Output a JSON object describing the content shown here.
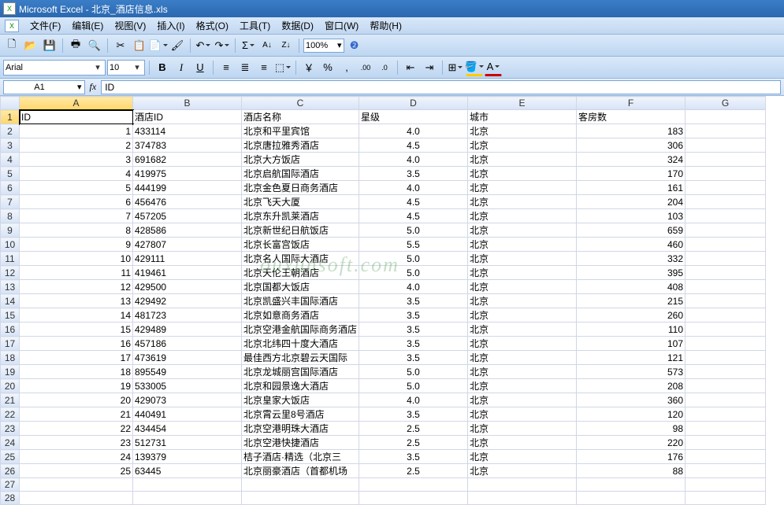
{
  "title": "Microsoft Excel - 北京_酒店信息.xls",
  "menus": [
    "文件(F)",
    "编辑(E)",
    "视图(V)",
    "插入(I)",
    "格式(O)",
    "工具(T)",
    "数据(D)",
    "窗口(W)",
    "帮助(H)"
  ],
  "font": {
    "name": "Arial",
    "size": "10"
  },
  "zoom": "100%",
  "namebox": "A1",
  "formula": "ID",
  "watermark": "ouxunsoft.com",
  "cols": [
    "A",
    "B",
    "C",
    "D",
    "E",
    "F",
    "G"
  ],
  "headers": [
    "ID",
    "酒店ID",
    "酒店名称",
    "星级",
    "城市",
    "客房数"
  ],
  "rows": [
    {
      "id": 1,
      "hid": "433114",
      "name": "北京和平里宾馆",
      "star": "4.0",
      "city": "北京",
      "rooms": "183"
    },
    {
      "id": 2,
      "hid": "374783",
      "name": "北京唐拉雅秀酒店",
      "star": "4.5",
      "city": "北京",
      "rooms": "306"
    },
    {
      "id": 3,
      "hid": "691682",
      "name": "北京大方饭店",
      "star": "4.0",
      "city": "北京",
      "rooms": "324"
    },
    {
      "id": 4,
      "hid": "419975",
      "name": "北京启航国际酒店",
      "star": "3.5",
      "city": "北京",
      "rooms": "170"
    },
    {
      "id": 5,
      "hid": "444199",
      "name": "北京金色夏日商务酒店",
      "star": "4.0",
      "city": "北京",
      "rooms": "161"
    },
    {
      "id": 6,
      "hid": "456476",
      "name": "北京飞天大厦",
      "star": "4.5",
      "city": "北京",
      "rooms": "204"
    },
    {
      "id": 7,
      "hid": "457205",
      "name": "北京东升凯莱酒店",
      "star": "4.5",
      "city": "北京",
      "rooms": "103"
    },
    {
      "id": 8,
      "hid": "428586",
      "name": "北京新世纪日航饭店",
      "star": "5.0",
      "city": "北京",
      "rooms": "659"
    },
    {
      "id": 9,
      "hid": "427807",
      "name": "北京长富宫饭店",
      "star": "5.5",
      "city": "北京",
      "rooms": "460"
    },
    {
      "id": 10,
      "hid": "429111",
      "name": "北京名人国际大酒店",
      "star": "5.0",
      "city": "北京",
      "rooms": "332"
    },
    {
      "id": 11,
      "hid": "419461",
      "name": "北京天伦王朝酒店",
      "star": "5.0",
      "city": "北京",
      "rooms": "395"
    },
    {
      "id": 12,
      "hid": "429500",
      "name": "北京国都大饭店",
      "star": "4.0",
      "city": "北京",
      "rooms": "408"
    },
    {
      "id": 13,
      "hid": "429492",
      "name": "北京凯盛兴丰国际酒店",
      "star": "3.5",
      "city": "北京",
      "rooms": "215"
    },
    {
      "id": 14,
      "hid": "481723",
      "name": "北京如意商务酒店",
      "star": "3.5",
      "city": "北京",
      "rooms": "260"
    },
    {
      "id": 15,
      "hid": "429489",
      "name": "北京空港金航国际商务酒店",
      "star": "3.5",
      "city": "北京",
      "rooms": "110"
    },
    {
      "id": 16,
      "hid": "457186",
      "name": "北京北纬四十度大酒店",
      "star": "3.5",
      "city": "北京",
      "rooms": "107"
    },
    {
      "id": 17,
      "hid": "473619",
      "name": "最佳西方北京碧云天国际",
      "star": "3.5",
      "city": "北京",
      "rooms": "121"
    },
    {
      "id": 18,
      "hid": "895549",
      "name": "北京龙城丽宫国际酒店",
      "star": "5.0",
      "city": "北京",
      "rooms": "573"
    },
    {
      "id": 19,
      "hid": "533005",
      "name": "北京和园景逸大酒店",
      "star": "5.0",
      "city": "北京",
      "rooms": "208"
    },
    {
      "id": 20,
      "hid": "429073",
      "name": "北京皇家大饭店",
      "star": "4.0",
      "city": "北京",
      "rooms": "360"
    },
    {
      "id": 21,
      "hid": "440491",
      "name": "北京霄云里8号酒店",
      "star": "3.5",
      "city": "北京",
      "rooms": "120"
    },
    {
      "id": 22,
      "hid": "434454",
      "name": "北京空港明珠大酒店",
      "star": "2.5",
      "city": "北京",
      "rooms": "98"
    },
    {
      "id": 23,
      "hid": "512731",
      "name": "北京空港快捷酒店",
      "star": "2.5",
      "city": "北京",
      "rooms": "220"
    },
    {
      "id": 24,
      "hid": "139379",
      "name": "桔子酒店·精选（北京三",
      "star": "3.5",
      "city": "北京",
      "rooms": "176"
    },
    {
      "id": 25,
      "hid": "63445",
      "name": "北京丽豪酒店（首都机场",
      "star": "2.5",
      "city": "北京",
      "rooms": "88"
    }
  ]
}
